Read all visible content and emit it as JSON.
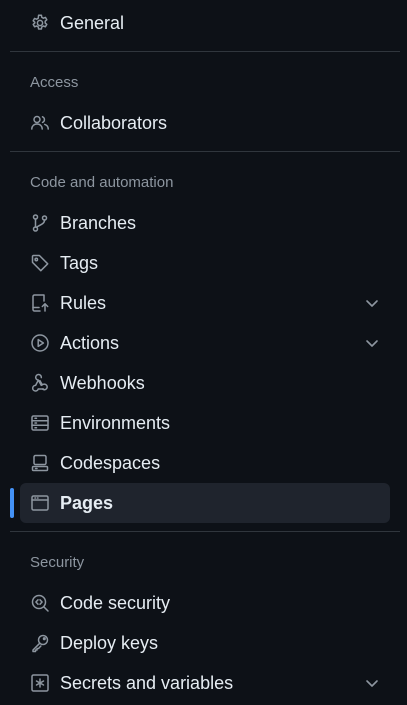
{
  "nav": {
    "general": {
      "label": "General",
      "icon": "gear-icon"
    },
    "access": {
      "heading": "Access",
      "collaborators": {
        "label": "Collaborators",
        "icon": "people-icon"
      }
    },
    "code_automation": {
      "heading": "Code and automation",
      "branches": {
        "label": "Branches",
        "icon": "git-branch-icon"
      },
      "tags": {
        "label": "Tags",
        "icon": "tag-icon"
      },
      "rules": {
        "label": "Rules",
        "icon": "repo-push-icon"
      },
      "actions": {
        "label": "Actions",
        "icon": "play-icon"
      },
      "webhooks": {
        "label": "Webhooks",
        "icon": "webhook-icon"
      },
      "environments": {
        "label": "Environments",
        "icon": "server-icon"
      },
      "codespaces": {
        "label": "Codespaces",
        "icon": "codespaces-icon"
      },
      "pages": {
        "label": "Pages",
        "icon": "browser-icon",
        "selected": true
      }
    },
    "security": {
      "heading": "Security",
      "code_security": {
        "label": "Code security",
        "icon": "codescan-icon"
      },
      "deploy_keys": {
        "label": "Deploy keys",
        "icon": "key-icon"
      },
      "secrets": {
        "label": "Secrets and variables",
        "icon": "asterisk-icon"
      }
    }
  },
  "colors": {
    "background": "#0d1117",
    "selected_bg": "#1f242d",
    "accent": "#4493f8",
    "text": "#e6edf3",
    "muted": "#8d96a0",
    "divider": "#30363d"
  }
}
